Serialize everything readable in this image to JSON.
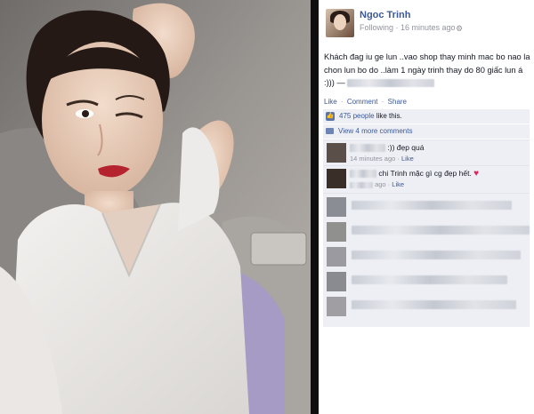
{
  "post": {
    "author_name": "Ngoc Trinh",
    "meta": "Following · 16 minutes ago ·",
    "settings_icon": "gear-icon",
    "caption": "Khách đag iu ge lun ..vao shop thay minh mac bo nao la chon lun bo do ..làm 1 ngày trinh thay do 80 giấc lun á :))) —",
    "actions": {
      "like": "Like",
      "comment": "Comment",
      "share": "Share",
      "sep": "·"
    },
    "likes": {
      "count_link": "475 people",
      "suffix": "like this."
    },
    "view_more": "View 4 more comments"
  },
  "comments": [
    {
      "text": ":)) đẹp quá",
      "time": "14 minutes ago",
      "sep": "·",
      "like": "Like"
    },
    {
      "text": "chi Trinh mặc gì cg đẹp hết.",
      "time": "ago",
      "sep": "·",
      "like": "Like",
      "emoji": "♥"
    }
  ],
  "colors": {
    "link": "#3b5998",
    "secondary": "#90949c",
    "comment_bg": "#edeff4",
    "photo_divider": "#0e0e0e"
  }
}
